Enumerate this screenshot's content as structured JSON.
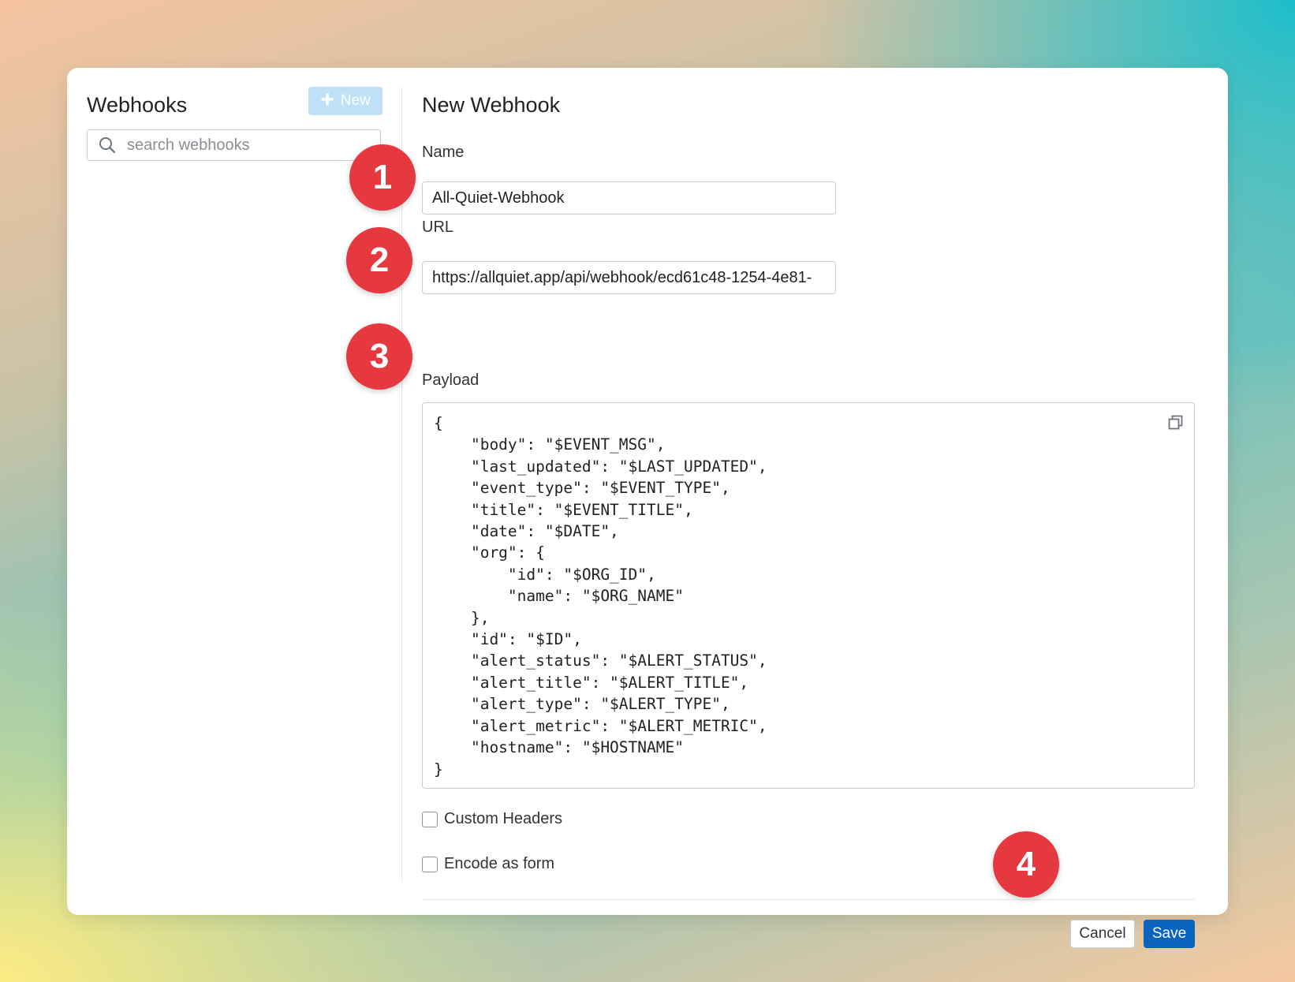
{
  "sidebar": {
    "title": "Webhooks",
    "new_button_label": "New",
    "search_placeholder": "search webhooks"
  },
  "form": {
    "title": "New Webhook",
    "name_label": "Name",
    "name_value": "All-Quiet-Webhook",
    "url_label": "URL",
    "url_value": "https://allquiet.app/api/webhook/ecd61c48-1254-4e81-",
    "payload_label": "Payload",
    "payload_value": "{\n    \"body\": \"$EVENT_MSG\",\n    \"last_updated\": \"$LAST_UPDATED\",\n    \"event_type\": \"$EVENT_TYPE\",\n    \"title\": \"$EVENT_TITLE\",\n    \"date\": \"$DATE\",\n    \"org\": {\n        \"id\": \"$ORG_ID\",\n        \"name\": \"$ORG_NAME\"\n    },\n    \"id\": \"$ID\",\n    \"alert_status\": \"$ALERT_STATUS\",\n    \"alert_title\": \"$ALERT_TITLE\",\n    \"alert_type\": \"$ALERT_TYPE\",\n    \"alert_metric\": \"$ALERT_METRIC\",\n    \"hostname\": \"$HOSTNAME\"\n}",
    "custom_headers_label": "Custom Headers",
    "custom_headers_checked": false,
    "encode_as_form_label": "Encode as form",
    "encode_as_form_checked": false,
    "cancel_label": "Cancel",
    "save_label": "Save"
  },
  "markers": [
    "1",
    "2",
    "3",
    "4"
  ],
  "colors": {
    "marker": "#e5393f",
    "primary_button": "#0a64bd",
    "new_button_disabled": "#bfe1f7"
  }
}
